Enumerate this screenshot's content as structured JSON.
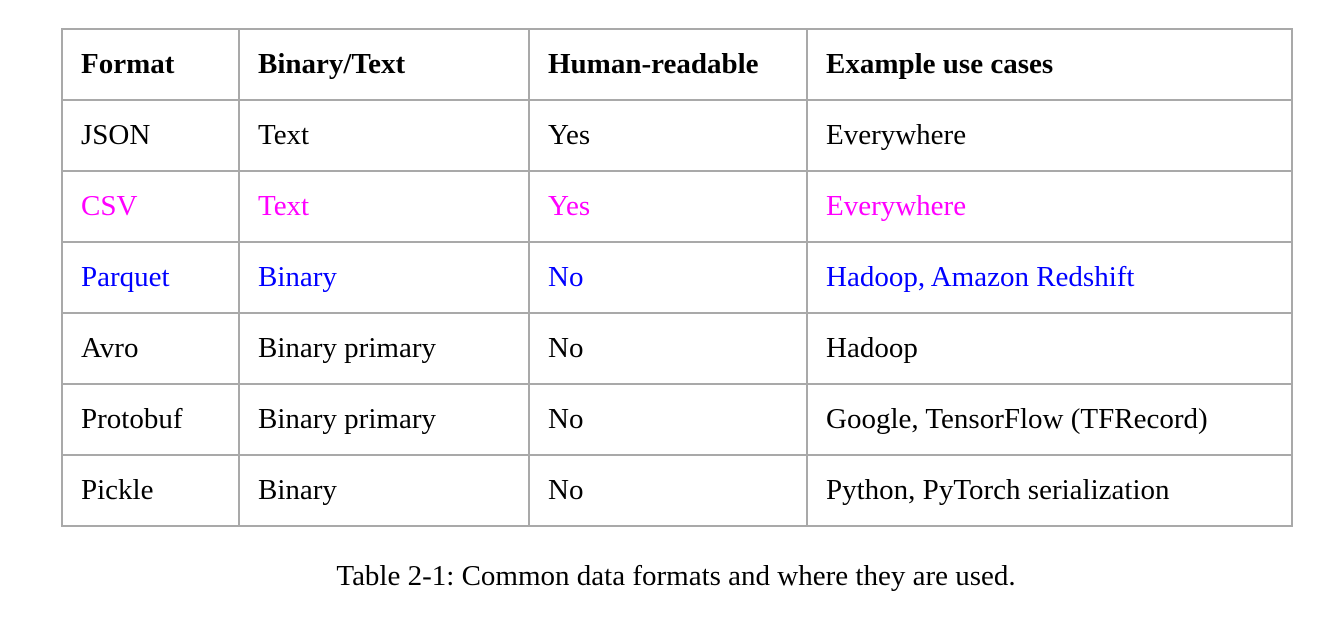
{
  "table": {
    "headers": [
      "Format",
      "Binary/Text",
      "Human-readable",
      "Example use cases"
    ],
    "rows": [
      {
        "cells": [
          "JSON",
          "Text",
          "Yes",
          "Everywhere"
        ],
        "color": "#000000"
      },
      {
        "cells": [
          "CSV",
          "Text",
          "Yes",
          "Everywhere"
        ],
        "color": "#ff00ff"
      },
      {
        "cells": [
          "Parquet",
          "Binary",
          "No",
          "Hadoop, Amazon Redshift"
        ],
        "color": "#0000ff"
      },
      {
        "cells": [
          "Avro",
          "Binary primary",
          "No",
          "Hadoop"
        ],
        "color": "#000000"
      },
      {
        "cells": [
          "Protobuf",
          "Binary primary",
          "No",
          "Google, TensorFlow (TFRecord)"
        ],
        "color": "#000000"
      },
      {
        "cells": [
          "Pickle",
          "Binary",
          "No",
          "Python, PyTorch serialization"
        ],
        "color": "#000000"
      }
    ]
  },
  "caption": "Table 2-1: Common data formats and where they are used."
}
